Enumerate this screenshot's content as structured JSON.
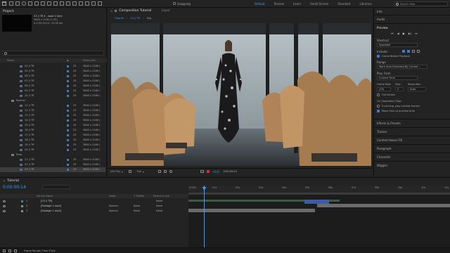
{
  "toolbar": {
    "snapping_label": "Snapping",
    "workspaces": [
      "Default",
      "Review",
      "Learn",
      "Small Screen",
      "Standard",
      "Libraries"
    ],
    "active_workspace": "Default",
    "search_placeholder": "Search Help"
  },
  "project": {
    "tab": "Project",
    "selected_name": "23 // TR ▾ , used 1 time",
    "selected_res": "3840 x 2160 (1.00)",
    "selected_dur": "Δ 0;00;00;24, 23.98 fps",
    "items_count": "8 bpc",
    "columns": {
      "name": "Name",
      "label": "",
      "type": "Video Info"
    },
    "rows": [
      {
        "indent": 2,
        "name": "04 // TR",
        "n": "25",
        "info": "3840 x 2160 (",
        "color": "#4a7ab8"
      },
      {
        "indent": 2,
        "name": "05 // TR",
        "n": "25",
        "info": "3840 x 2160 (",
        "color": "#4a7ab8"
      },
      {
        "indent": 2,
        "name": "06 // TR",
        "n": "25",
        "info": "3840 x 2160 (",
        "color": "#4a7ab8"
      },
      {
        "indent": 2,
        "name": "07 // TR",
        "n": "25",
        "info": "3840 x 2160 (",
        "color": "#4a7ab8"
      },
      {
        "indent": 2,
        "name": "08 // TR",
        "n": "25",
        "info": "3840 x 2160 (",
        "color": "#4a7ab8"
      },
      {
        "indent": 2,
        "name": "09 // TR",
        "n": "25",
        "info": "3840 x 2160 (",
        "color": "#4a7ab8"
      },
      {
        "indent": 2,
        "name": "10 // TR",
        "n": "25",
        "info": "3840 x 2160 (",
        "color": "#4a7ab8"
      },
      {
        "indent": 1,
        "name": "Normal",
        "n": "",
        "info": "",
        "color": "#c9a86a",
        "folder": true
      },
      {
        "indent": 2,
        "name": "11 // TR",
        "n": "25",
        "info": "3840 x 2160 (",
        "color": "#4a7ab8"
      },
      {
        "indent": 2,
        "name": "12 // TR",
        "n": "25",
        "info": "3840 x 2160 (",
        "color": "#4a7ab8"
      },
      {
        "indent": 2,
        "name": "13 // TR",
        "n": "25",
        "info": "3840 x 2160 (",
        "color": "#4a7ab8"
      },
      {
        "indent": 2,
        "name": "14 // TR",
        "n": "25",
        "info": "3840 x 2160 (",
        "color": "#4a7ab8"
      },
      {
        "indent": 2,
        "name": "15 // TR",
        "n": "25",
        "info": "3840 x 2160 (",
        "color": "#4a7ab8"
      },
      {
        "indent": 2,
        "name": "16 // TR",
        "n": "25",
        "info": "3840 x 2160 (",
        "color": "#4a7ab8"
      },
      {
        "indent": 2,
        "name": "17 // TR",
        "n": "25",
        "info": "3840 x 2160 (",
        "color": "#4a7ab8"
      },
      {
        "indent": 2,
        "name": "18 // TR",
        "n": "25",
        "info": "3840 x 2160 (",
        "color": "#4a7ab8"
      },
      {
        "indent": 2,
        "name": "19 // TR",
        "n": "25",
        "info": "3840 x 2160 (",
        "color": "#4a7ab8"
      },
      {
        "indent": 2,
        "name": "20 // TR",
        "n": "25",
        "info": "3840 x 2160 (",
        "color": "#4a7ab8"
      },
      {
        "indent": 1,
        "name": "Slow",
        "n": "",
        "info": "",
        "color": "#c9a86a",
        "folder": true
      },
      {
        "indent": 2,
        "name": "21 // TR",
        "n": "25",
        "info": "3840 x 2160 (",
        "color": "#4a7ab8"
      },
      {
        "indent": 2,
        "name": "22 // TR",
        "n": "25",
        "info": "3840 x 2160 (",
        "color": "#4a7ab8"
      },
      {
        "indent": 2,
        "name": "23 // TR",
        "n": "25",
        "info": "3840 x 2160 (",
        "color": "#4a7ab8",
        "selected": true
      }
    ]
  },
  "comp": {
    "tab": "Composition Tutorial",
    "layer_tab": "Layer",
    "breadcrumbs": [
      "Tutorial",
      "23 // TR",
      "Slip"
    ],
    "zoom": "(49.7%)",
    "resolution": "Full",
    "timecode": "0;00;00;14"
  },
  "right": {
    "info": "Info",
    "audio": "Audio",
    "preview": "Preview",
    "shortcut_label": "Shortcut",
    "shortcut_value": "Spacebar",
    "include_label": "Include:",
    "cache_label": "Cache Before Playback",
    "range_label": "Range",
    "range_value": "Work Area Extended By Current ...",
    "play_from_label": "Play From",
    "play_from_value": "Current Time",
    "frame_rate_label": "Frame Rate",
    "skip_label": "Skip",
    "resolution_label": "Resolution",
    "frame_rate_value": "(25)",
    "skip_value": "0",
    "resolution_value": "Auto",
    "full_screen_label": "Full Screen",
    "stop_label": "On (Spacebar) Stop:",
    "if_caching_label": "If caching, play cached frames",
    "move_time_label": "Move time to preview time",
    "sections": [
      "Effects & Presets",
      "Tracker",
      "Content-Aware Fill",
      "Paragraph",
      "Character",
      "Wiggler"
    ]
  },
  "timeline": {
    "tab": "Tutorial",
    "timecode": "0:00:00:14",
    "columns": {
      "source": "Source Name",
      "mode": "Mode",
      "trkmat": "T TrkMat",
      "parent": "Parent & Link"
    },
    "layers": [
      {
        "num": "1",
        "name": "[23 // TR]",
        "mode": "",
        "trkmat": "",
        "parent": "None",
        "color": "#4a7ab8"
      },
      {
        "num": "2",
        "name": "[Footage 1.mp4]",
        "mode": "Normal",
        "trkmat": "None",
        "parent": "None",
        "color": "#7a9a6a"
      },
      {
        "num": "3",
        "name": "[Footage 1.mp4]",
        "mode": "Normal",
        "trkmat": "None",
        "parent": "None",
        "color": "#7a9a6a"
      }
    ],
    "ruler": [
      "0:00s",
      "01s",
      "02s",
      "03s",
      "04s",
      "05s",
      "06s",
      "07s",
      "08s",
      "09s",
      "10s",
      "11s"
    ],
    "status": "Frame Render Time  53ms"
  },
  "colors": {
    "accent": "#3b9aff",
    "bar_green": "#3a5c45",
    "bar_blue": "#3d5b9e",
    "bar_gray": "#6b6b6b"
  }
}
